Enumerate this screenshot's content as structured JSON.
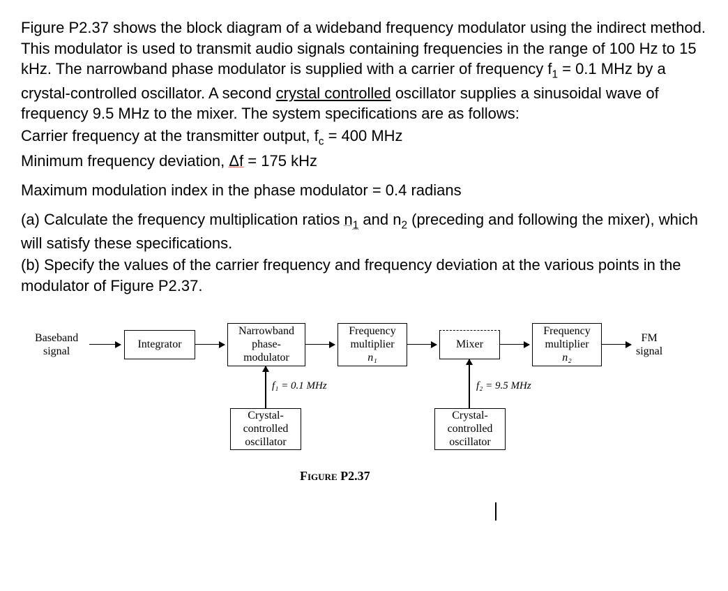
{
  "problem": {
    "intro_p1": "Figure P2.37 shows the block diagram of a wideband frequency modulator using the indirect method. This modulator is used to transmit audio signals containing frequencies in the range of 100 Hz to 15 kHz. The narrowband phase modulator is supplied with a carrier of frequency f",
    "intro_sub1": "1",
    "intro_p2": " = 0.1 MHz by a crystal-controlled oscillator. A second ",
    "intro_crystal": "crystal controlled",
    "intro_p3": " oscillator supplies a sinusoidal wave of frequency 9.5 MHz to the mixer. The system specifications are as follows:",
    "carrier_line_p1": "Carrier frequency at the transmitter output, f",
    "carrier_line_sub": "c",
    "carrier_line_p2": " = 400 MHz",
    "dev_line_p1": "Minimum frequency deviation, ",
    "dev_line_delta": "Δf",
    "dev_line_p2": " = 175 kHz",
    "max_mod": "Maximum modulation index in the phase modulator = 0.4 radians",
    "part_a_p1": "(a) Calculate the frequency multiplication ratios ",
    "part_a_n1": "n",
    "part_a_n1_sub": "1",
    "part_a_p2": " and n",
    "part_a_n2_sub": "2",
    "part_a_p3": " (preceding and following the mixer), which will satisfy these specifications.",
    "part_b": "(b) Specify the values of the carrier frequency and frequency deviation at the various points in the modulator of Figure P2.37."
  },
  "diagram": {
    "baseband_l1": "Baseband",
    "baseband_l2": "signal",
    "integrator": "Integrator",
    "npm_l1": "Narrowband",
    "npm_l2": "phase-",
    "npm_l3": "modulator",
    "fm1_l1": "Frequency",
    "fm1_l2": "multiplier",
    "fm1_l3": "n₁",
    "mixer": "Mixer",
    "fm2_l1": "Frequency",
    "fm2_l2": "multiplier",
    "fm2_l3": "n₂",
    "fmout_l1": "FM",
    "fmout_l2": "signal",
    "osc1_l1": "Crystal-",
    "osc1_l2": "controlled",
    "osc1_l3": "oscillator",
    "osc2_l1": "Crystal-",
    "osc2_l2": "controlled",
    "osc2_l3": "oscillator",
    "f1_label": "f₁ = 0.1 MHz",
    "f2_label": "f₂ = 9.5 MHz",
    "caption_bold": "Figure",
    "caption_rest": " P2.37"
  }
}
